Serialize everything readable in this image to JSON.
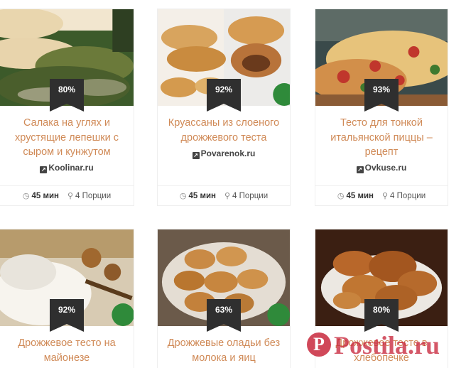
{
  "cards": [
    {
      "title": "Салака на углях и хрустящие лепешки с сыром и кунжутом",
      "rating": "80%",
      "source": "Koolinar.ru",
      "time": "45 мин",
      "portions": "4 Порции"
    },
    {
      "title": "Круассаны из слоеного дрожжевого теста",
      "rating": "92%",
      "source": "Povarenok.ru",
      "time": "45 мин",
      "portions": "4 Порции"
    },
    {
      "title": "Тесто для тонкой итальянской пиццы – рецепт",
      "rating": "93%",
      "source": "Ovkuse.ru",
      "time": "45 мин",
      "portions": "4 Порции"
    },
    {
      "title": "Дрожжевое тесто на майонезе",
      "rating": "92%"
    },
    {
      "title": "Дрожжевые оладьи без молока и яиц",
      "rating": "63%"
    },
    {
      "title": "Дрожжевое тесто в хлебопечке",
      "rating": "80%"
    }
  ],
  "watermark": {
    "text": "Postila.ru",
    "pin": "P"
  },
  "colors": {
    "title": "#d08a57",
    "ribbon": "#2f2f2f",
    "watermark": "#c8283c"
  }
}
